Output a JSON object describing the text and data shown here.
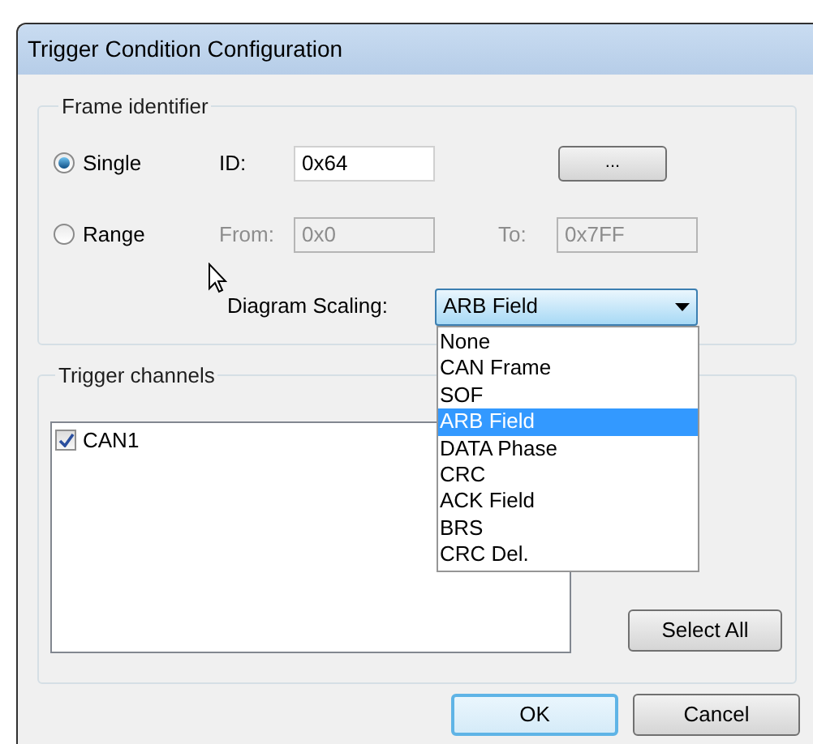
{
  "window": {
    "title": "Trigger Condition Configuration"
  },
  "frame_identifier": {
    "legend": "Frame identifier",
    "modes": [
      {
        "label": "Single",
        "selected": true
      },
      {
        "label": "Range",
        "selected": false
      }
    ],
    "id": {
      "label": "ID:",
      "value": "0x64",
      "disabled": false
    },
    "browse_button": "...",
    "from": {
      "label": "From:",
      "value": "0x0",
      "disabled": true
    },
    "to": {
      "label": "To:",
      "value": "0x7FF",
      "disabled": true
    },
    "diagram_scaling": {
      "label": "Diagram Scaling:",
      "value": "ARB Field",
      "expanded": true,
      "options": [
        {
          "label": "None",
          "selected": false
        },
        {
          "label": "CAN Frame",
          "selected": false
        },
        {
          "label": "SOF",
          "selected": false
        },
        {
          "label": "ARB Field",
          "selected": true
        },
        {
          "label": "DATA Phase",
          "selected": false
        },
        {
          "label": "CRC",
          "selected": false
        },
        {
          "label": "ACK Field",
          "selected": false
        },
        {
          "label": "BRS",
          "selected": false
        },
        {
          "label": "CRC Del.",
          "selected": false
        }
      ]
    }
  },
  "trigger_channels": {
    "legend": "Trigger channels",
    "channels": [
      {
        "label": "CAN1",
        "checked": true
      }
    ],
    "select_all": "Select All"
  },
  "buttons": [
    {
      "label": "OK",
      "default": true
    },
    {
      "label": "Cancel",
      "default": false
    }
  ]
}
